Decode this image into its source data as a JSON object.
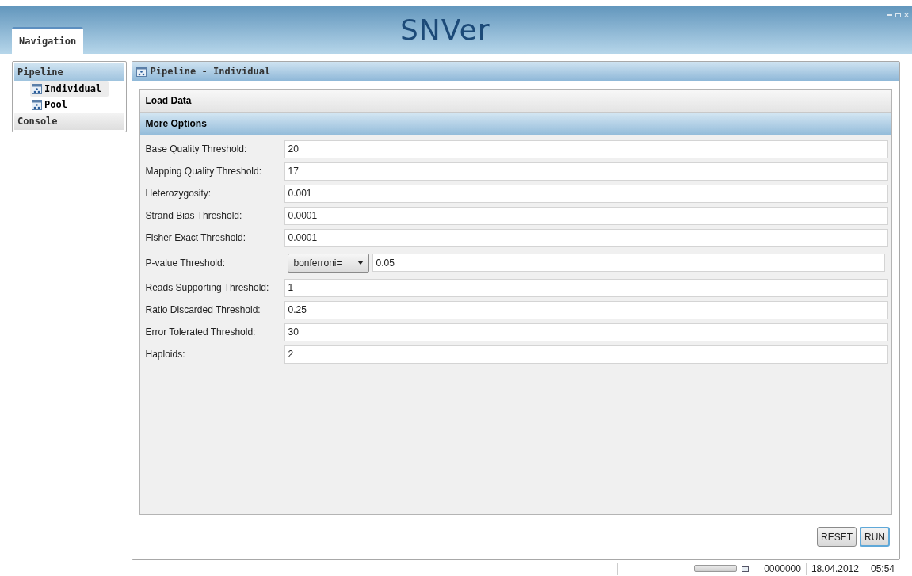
{
  "app": {
    "logo": "SNVer"
  },
  "tabs": [
    {
      "label": "Navigation",
      "selected": true
    }
  ],
  "navigation": {
    "sections": [
      {
        "label": "Pipeline",
        "expanded": true,
        "children": [
          {
            "label": "Individual",
            "selected": true
          },
          {
            "label": "Pool",
            "selected": false
          }
        ]
      },
      {
        "label": "Console",
        "expanded": false
      }
    ]
  },
  "editor": {
    "title": "Pipeline - Individual",
    "sections": [
      {
        "label": "Load Data",
        "expanded": false
      },
      {
        "label": "More Options",
        "expanded": true
      }
    ],
    "fields": [
      {
        "kind": "text",
        "label": "Base Quality Threshold:",
        "value": "20"
      },
      {
        "kind": "text",
        "label": "Mapping Quality Threshold:",
        "value": "17"
      },
      {
        "kind": "text",
        "label": "Heterozygosity:",
        "value": "0.001"
      },
      {
        "kind": "text",
        "label": "Strand Bias Threshold:",
        "value": "0.0001"
      },
      {
        "kind": "text",
        "label": "Fisher Exact Threshold:",
        "value": "0.0001"
      },
      {
        "kind": "select",
        "label": "P-value Threshold:",
        "option": "bonferroni=",
        "value": "0.05"
      },
      {
        "kind": "text",
        "label": "Reads Supporting Threshold:",
        "value": "1"
      },
      {
        "kind": "text",
        "label": "Ratio Discarded Threshold:",
        "value": "0.25"
      },
      {
        "kind": "text",
        "label": "Error Tolerated Threshold:",
        "value": "30"
      },
      {
        "kind": "text",
        "label": "Haploids:",
        "value": "2"
      }
    ],
    "buttons": [
      {
        "label": "RESET",
        "focused": false
      },
      {
        "label": "RUN",
        "focused": true
      }
    ]
  },
  "status_bar": {
    "progress": {
      "level": 0
    },
    "counter": "0000000",
    "date": "18.04.2012",
    "time": "05:54"
  }
}
